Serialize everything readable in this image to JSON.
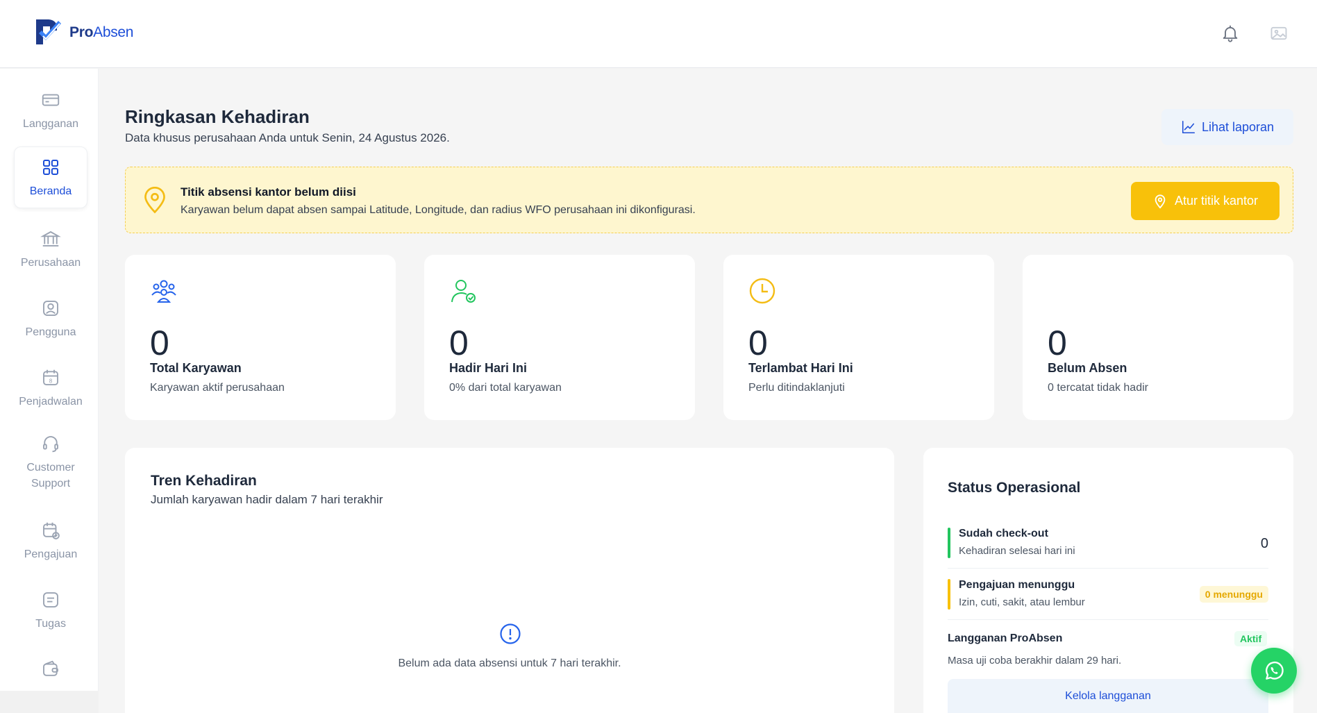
{
  "app": {
    "name_bold": "Pro",
    "name_rest": "Absen",
    "accent": "#1d4ed8",
    "warning": "#f8c10a",
    "success": "#22c55e"
  },
  "header": {
    "notification_icon": "bell-icon",
    "avatar_icon": "image-icon"
  },
  "sidebar": {
    "items": [
      {
        "label": "Langganan",
        "icon": "credit-card-icon"
      },
      {
        "label": "Beranda",
        "icon": "grid-icon",
        "active": true
      },
      {
        "label": "Perusahaan",
        "icon": "bank-icon"
      },
      {
        "label": "Pengguna",
        "icon": "user-square-icon"
      },
      {
        "label": "Penjadwalan",
        "icon": "calendar-icon"
      },
      {
        "label": "Customer Support",
        "icon": "headset-icon"
      },
      {
        "label": "Pengajuan",
        "icon": "calendar-check-icon"
      },
      {
        "label": "Tugas",
        "icon": "task-list-icon"
      },
      {
        "label": "",
        "icon": "wallet-icon"
      }
    ]
  },
  "main": {
    "title": "Ringkasan Kehadiran",
    "subtitle": "Data khusus perusahaan Anda untuk Senin, 24 Agustus 2026.",
    "report_button": "Lihat laporan"
  },
  "alert": {
    "title": "Titik absensi kantor belum diisi",
    "text": "Karyawan belum dapat absen sampai Latitude, Longitude, dan radius WFO perusahaan ini dikonfigurasi.",
    "button": "Atur titik kantor"
  },
  "stats": [
    {
      "value": "0",
      "label": "Total Karyawan",
      "sub": "Karyawan aktif perusahaan",
      "icon": "users-icon"
    },
    {
      "value": "0",
      "label": "Hadir Hari Ini",
      "sub": "0% dari total karyawan",
      "icon": "user-check-icon"
    },
    {
      "value": "0",
      "label": "Terlambat Hari Ini",
      "sub": "Perlu ditindaklanjuti",
      "icon": "clock-icon"
    },
    {
      "value": "0",
      "label": "Belum Absen",
      "sub": "0 tercatat tidak hadir",
      "icon": ""
    }
  ],
  "trend": {
    "title": "Tren Kehadiran",
    "subtitle": "Jumlah karyawan hadir dalam 7 hari terakhir",
    "empty": "Belum ada data absensi untuk 7 hari terakhir."
  },
  "ops": {
    "title": "Status Operasional",
    "rows": [
      {
        "title": "Sudah check-out",
        "sub": "Kehadiran selesai hari ini",
        "value": "0"
      },
      {
        "title": "Pengajuan menunggu",
        "sub": "Izin, cuti, sakit, atau lembur",
        "badge": "0 menunggu"
      }
    ],
    "subscription": {
      "title": "Langganan ProAbsen",
      "status": "Aktif",
      "text": "Masa uji coba berakhir dalam 29 hari.",
      "button": "Kelola langganan"
    }
  },
  "chat": {
    "icon": "whatsapp-icon"
  }
}
